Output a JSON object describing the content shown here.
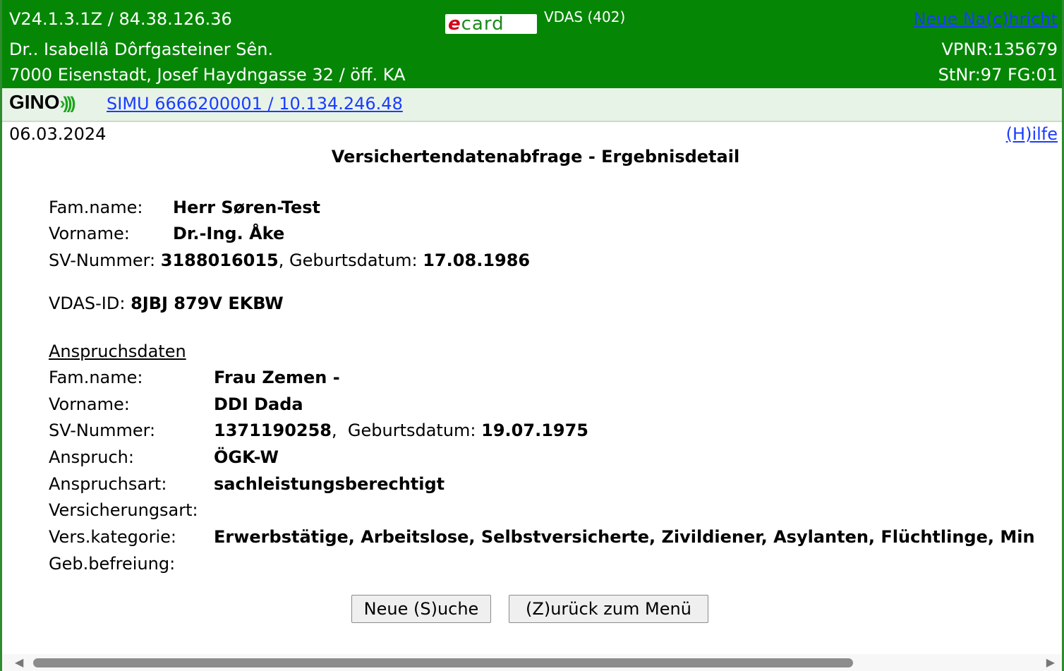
{
  "header": {
    "version_ip": "V24.1.3.1Z / 84.38.126.36",
    "logo_text_e": "e",
    "logo_text_rest": "card",
    "module": "VDAS (402)",
    "new_message_link": "Neue Na(c)hricht",
    "doctor_name": "Dr.. Isabellâ Dôrfgasteiner Sên.",
    "vpnr": "VPNR:135679",
    "address": "7000 Eisenstadt, Josef Haydngasse 32 / öff. KA",
    "stnr_fg": "StNr:97 FG:01",
    "header_bg": "#058705"
  },
  "gino": {
    "logo": "GINO",
    "link": "SIMU 6666200001 / 10.134.246.48"
  },
  "date": "06.03.2024",
  "help_link": "(H)ilfe",
  "title": "Versichertendatenabfrage - Ergebnisdetail",
  "insured": {
    "famname_label": "Fam.name:",
    "famname": "Herr Søren-Test",
    "vorname_label": "Vorname:",
    "vorname": "Dr.-Ing. Åke",
    "svnr_label": "SV-Nummer:",
    "svnr": "3188016015",
    "sep": ", Geburtsdatum:",
    "geburtsdatum": "17.08.1986"
  },
  "vdas": {
    "label": "VDAS-ID:",
    "value": "8JBJ 879V EKBW"
  },
  "anspruch": {
    "heading": "Anspruchsdaten",
    "famname_label": "Fam.name:",
    "famname": "Frau Zemen -",
    "vorname_label": "Vorname:",
    "vorname": "DDI Dada",
    "svnr_label": "SV-Nummer:",
    "svnr": "1371190258",
    "sep": ",  Geburtsdatum:",
    "geburtsdatum": "19.07.1975",
    "anspruch_label": "Anspruch:",
    "anspruch": "ÖGK-W",
    "anspruchsart_label": "Anspruchsart:",
    "anspruchsart": "sachleistungsberechtigt",
    "versicherungsart_label": "Versicherungsart:",
    "versicherungsart": "",
    "verskategorie_label": "Vers.kategorie:",
    "verskategorie": "Erwerbstätige, Arbeitslose, Selbstversicherte, Zivildiener, Asylanten, Flüchtlinge, Min",
    "gebbefreiung_label": "Geb.befreiung:",
    "gebbefreiung": ""
  },
  "buttons": {
    "new_search": "Neue (S)uche",
    "back": "(Z)urück zum Menü"
  }
}
